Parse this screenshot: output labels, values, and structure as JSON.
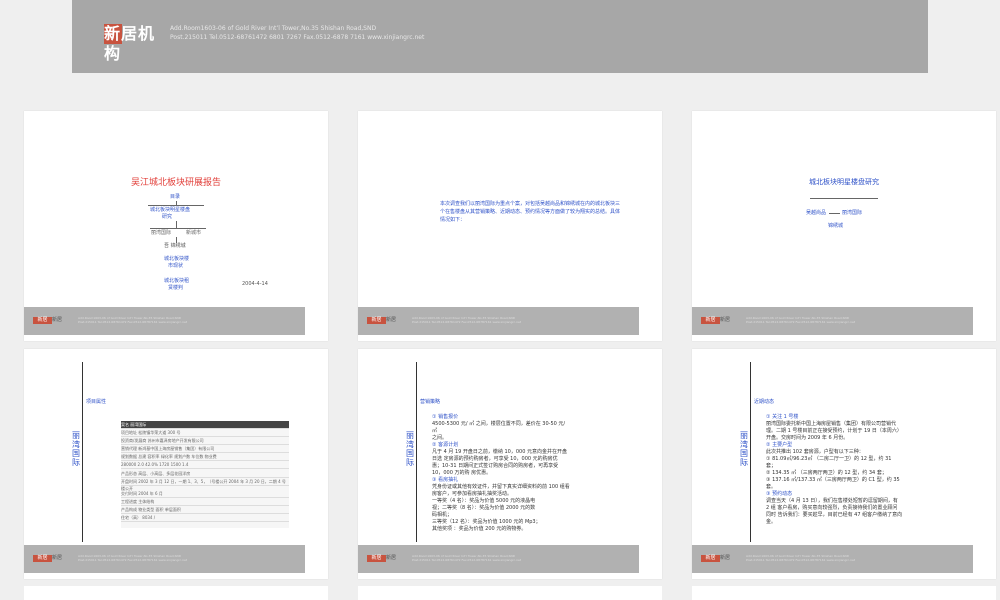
{
  "top": {
    "logo_text": "新居机构",
    "address_line": "Add.Room1603-06 of Gold River Int’l Tower,No.35 Shishan Road,SND",
    "contact_line": "Post.215011  Tel.0512-68761472  6801 7267  Fax.0512-6878 7161  www.xinjiangrc.net"
  },
  "footer": {
    "logo": "新居",
    "brand": "新居",
    "line1": "Add.Room1603-06 of Gold River Int’l Tower,No.35 Shishan Road,SND",
    "line2": "Post.215011 Tel.0512-68761472 Fax.0512-68787161 www.xinjiangrc.net"
  },
  "slide1": {
    "title": "吴江城北板块研展报告",
    "node_root": "目录",
    "node_1": "城北板块明星楼盘",
    "node_1b": "研究",
    "node_2": "丽湾国际",
    "node_3": "新城市",
    "node_4": "吾  锦绣城",
    "node_5": "城北板块楼",
    "node_5b": "市现状",
    "node_6": "城北板块租",
    "node_6b": "赁楼判",
    "date": "2004-4-14"
  },
  "slide2": {
    "para": "本次调查我们以丽湾国际为重点个案，对包括吴越尚品和锦绣城在内的城北板块三个在售楼盘从其营销策略、近期动态、预约情况等方面做了较为翔实的总结。具体情况如下："
  },
  "slide3": {
    "title": "城北板块明星楼盘研究",
    "item_1": "吴越尚品",
    "item_2": "丽湾国际",
    "item_3": "锦绣城"
  },
  "brand_vertical": "丽湾国际",
  "slide4": {
    "label": "项目属性",
    "table": [
      "案名    丽湾国际",
      "项目地址    松陵镇华荣大道 300 号",
      "投资商/发展商  苏州市嘉泽房地产开发有限公司",
      "营销代理  新鸿基中国上海房屋销售（集团）有限公司",
      "规划数据  总建  容积率  绿化率  规划户数  车位数  物业费",
      "280000  2.0  42.0%  1720  1500  1.4",
      "产品形态    高层、小高层、多层花园洋房",
      "开盘时间  2002 年 3 月 12 日，一期 1、3、5，（号楼公开  2004 年 3 月 20 日，二期 4 号楼公开",
      "交付时间    2004 年 6 月",
      "工程进度    主体结构",
      "产品构成  物业类型  面积  单层面积",
      "          住宅（高）  8034  /"
    ]
  },
  "slide5": {
    "label": "营销策略",
    "lines": [
      "① 销售报价",
      "4500-5300 元/ ㎡ 之间，楼层位置不同，差价在 30-50 元/",
      "㎡",
      "之间。",
      "② 客源计划",
      "凡于 4 月 19 开盘日之前，缴纳 10，000 元意向金并在开盘",
      "日选 定房源的预约购房者，可享受 10，000 元的购房优",
      "惠；10-31  日期间正式签订购房合同的购房者，可再享受",
      "10，000 万的购 房优惠。",
      "③ 看房抽礼",
      "凭身份证或其他有效证件，并留下真实详细资料的前 100 组看",
      "房客户，可参加看房抽礼抽奖活动。",
      "一等奖（4 名）：奖品为价值 5000 元的液晶电",
      "视；二等奖（8 名）：奖品为价值 2000 元的数",
      "码相机；",
      "三等奖（12 名）：奖品为价值 1000 元的 Mp3；",
      "其他奖项      ：奖品为价值 200 元的购物券。"
    ]
  },
  "slide6": {
    "label": "近期动态",
    "lines": [
      "① 关注 1 号楼",
      "丽湾国际委托新中国上海房屋销售（集团）有限公司营销代",
      "理。二期 1 号楼目前正在接受预约，计划于 19 日（本周六）",
      "开盘。交房时间为 2009 年 6 月份。",
      "② 主要户型",
      "此次共推出 102 套房源，户型有以下三种：",
      "① 81.09㎡/96.23㎡ （二房二厅一卫）的 12 型，约 31",
      "套；",
      "② 134.35 ㎡ （三房两厅两卫）的 12 型，约 34 套；",
      "③ 137.16 ㎡/137.33 ㎡（三房两厅两卫）的 C1 型，约 35",
      "套。",
      "③ 预约动态",
      "调查当天（4 月 13 日），我们在售楼处短暂的逗留期间，有",
      "2 组 客户看房，购买意向较强烈，负责接待我们的置业顾问",
      "同时 告诉我们：要买趁早，目前已经有 47 组客户缴纳了意向",
      "金。"
    ]
  },
  "colors": {
    "accent_blue": "#2f52c8",
    "accent_red": "#e2403b",
    "footer_gray": "#b1b1b1"
  }
}
